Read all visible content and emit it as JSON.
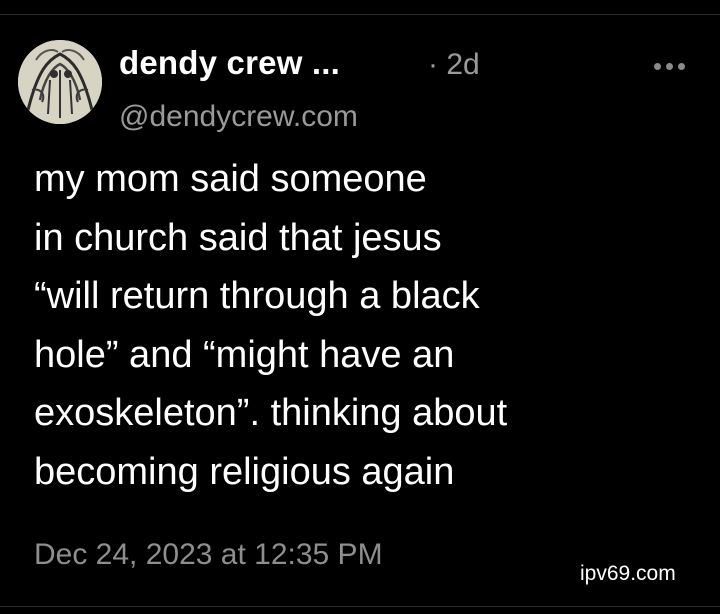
{
  "post": {
    "author_name": "dendy crew ...",
    "time_ago": "· 2d",
    "handle": "@dendycrew.com",
    "body_lines": [
      "my mom said someone",
      "in church said that jesus",
      "“will return through a black",
      "hole” and “might have an",
      "exoskeleton”.  thinking about",
      "becoming religious again"
    ],
    "timestamp": "Dec 24, 2023 at 12:35 PM"
  },
  "icons": {
    "more": "more-options-icon",
    "avatar": "avatar-image"
  },
  "watermark": "ipv69.com",
  "colors": {
    "background": "#000000",
    "text": "#ffffff",
    "muted": "#9a9a9a"
  }
}
